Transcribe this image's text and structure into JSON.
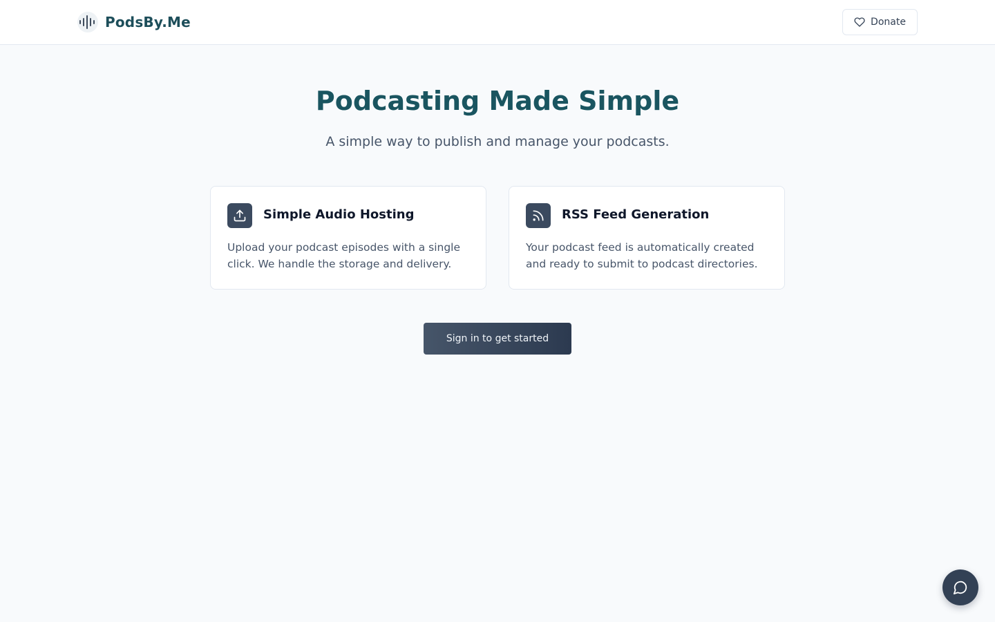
{
  "header": {
    "brand": "PodsBy.Me",
    "donate_label": "Donate",
    "logo_icon": "waveform-icon",
    "donate_icon": "heart-icon"
  },
  "hero": {
    "title": "Podcasting Made Simple",
    "subtitle": "A simple way to publish and manage your podcasts."
  },
  "features": [
    {
      "icon": "upload-icon",
      "title": "Simple Audio Hosting",
      "text": "Upload your podcast episodes with a single click. We handle the storage and delivery."
    },
    {
      "icon": "rss-icon",
      "title": "RSS Feed Generation",
      "text": "Your podcast feed is automatically created and ready to submit to podcast directories."
    }
  ],
  "cta": {
    "label": "Sign in to get started"
  },
  "chat": {
    "icon": "chat-bubble-icon"
  },
  "colors": {
    "brand": "#1d4e5a",
    "title": "#1a5560",
    "icon_bg": "#3b4a5f",
    "page_bg": "#f8fafc"
  }
}
